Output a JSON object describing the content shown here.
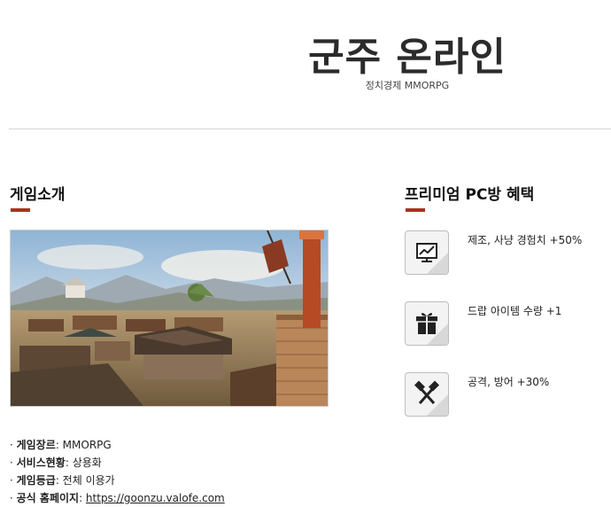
{
  "header": {
    "title": "군주 온라인",
    "subtitle": "정치경제 MMORPG"
  },
  "intro": {
    "heading": "게임소개",
    "accent_color": "#a8341f",
    "info": [
      {
        "label": "게임장르",
        "value": "MMORPG"
      },
      {
        "label": "서비스현황",
        "value": "상용화"
      },
      {
        "label": "게임등급",
        "value": "전체 이용가"
      },
      {
        "label": "공식 홈페이지",
        "value": "https://goonzu.valofe.com"
      }
    ]
  },
  "benefits": {
    "heading": "프리미엄 PC방 혜택",
    "items": [
      {
        "icon": "chart-icon",
        "text": "제조, 사냥 경험치 +50%"
      },
      {
        "icon": "gift-icon",
        "text": "드랍 아이템 수량 +1"
      },
      {
        "icon": "crossed-hammers-icon",
        "text": "공격, 방어 +30%"
      }
    ]
  }
}
